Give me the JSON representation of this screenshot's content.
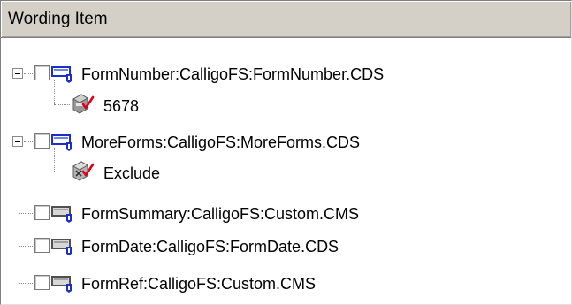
{
  "header": {
    "title": "Wording Item"
  },
  "tree": [
    {
      "label": "FormNumber:CalligoFS:FormNumber.CDS",
      "icon": "blue-doc-link-icon",
      "expanded": true,
      "checked": false,
      "child": {
        "label": "5678",
        "icon": "value-field-checked-icon"
      }
    },
    {
      "label": "MoreForms:CalligoFS:MoreForms.CDS",
      "icon": "blue-doc-link-icon",
      "expanded": true,
      "checked": false,
      "child": {
        "label": "Exclude",
        "icon": "excluded-field-checked-icon"
      }
    },
    {
      "label": "FormSummary:CalligoFS:Custom.CMS",
      "icon": "gray-doc-link-icon",
      "checked": false
    },
    {
      "label": "FormDate:CalligoFS:FormDate.CDS",
      "icon": "gray-doc-link-icon",
      "checked": false
    },
    {
      "label": "FormRef:CalligoFS:Custom.CMS",
      "icon": "gray-doc-link-icon",
      "checked": false
    }
  ],
  "colors": {
    "header_bg": "#d4d0c8",
    "tree_line": "#8a8a8a",
    "icon_blue": "#1c2fc8",
    "check_red": "#e0001c"
  }
}
